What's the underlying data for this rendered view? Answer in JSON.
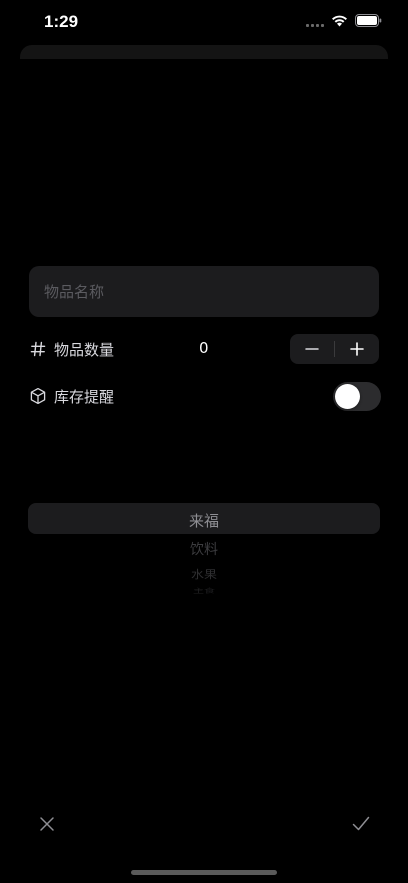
{
  "status_bar": {
    "time": "1:29"
  },
  "form": {
    "name_placeholder": "物品名称",
    "quantity": {
      "label": "物品数量",
      "value": "0"
    },
    "stock_reminder": {
      "label": "库存提醒",
      "enabled": false
    }
  },
  "picker": {
    "options": [
      "来福",
      "饮料",
      "水果",
      "主食"
    ],
    "selected": "来福"
  },
  "colors": {
    "background": "#000000",
    "field_background": "#1c1c1e",
    "placeholder": "#5b5b60",
    "toggle_off": "#2c2c2e"
  }
}
